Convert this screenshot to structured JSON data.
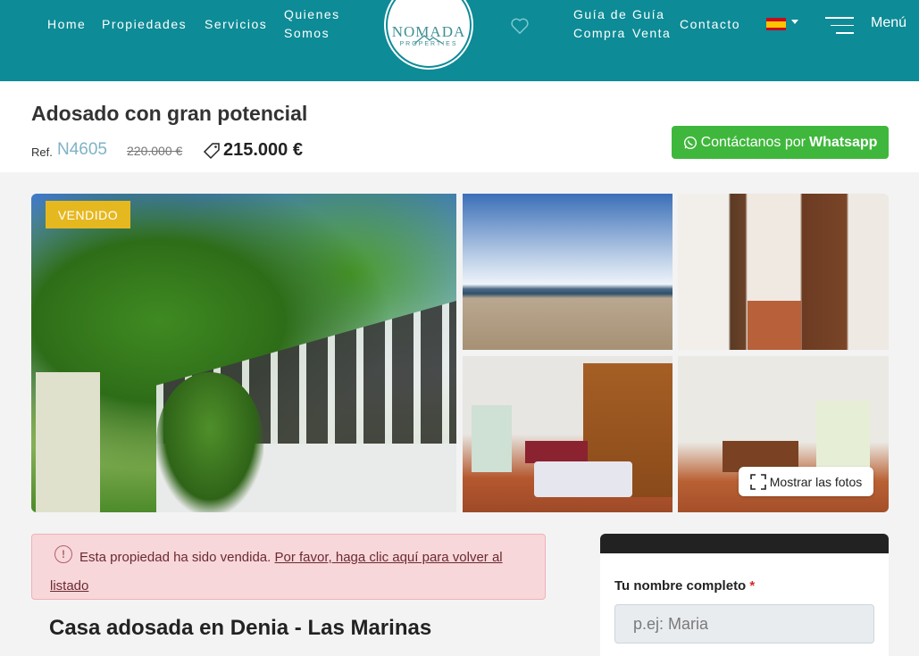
{
  "header": {
    "nav": [
      {
        "label": "Home"
      },
      {
        "label": "Propiedades"
      },
      {
        "label": "Servicios"
      },
      {
        "label": "Quienes Somos"
      },
      {
        "label": "Guía de Compra"
      },
      {
        "label": "Guía Venta"
      },
      {
        "label": "Contacto"
      }
    ],
    "logo_text": "NOMADA",
    "logo_sub": "PROPERTIES",
    "menu_label": "Menú",
    "language": "es"
  },
  "property": {
    "title": "Adosado con gran potencial",
    "ref_label": "Ref.",
    "ref": "N4605",
    "old_price": "220.000 €",
    "price": "215.000 €",
    "whatsapp_prefix": "Contáctanos por",
    "whatsapp_bold": "Whatsapp",
    "badge": "VENDIDO",
    "show_photos": "Mostrar las fotos",
    "subtitle": "Casa adosada en Denia  -  Las Marinas"
  },
  "alert": {
    "text": "Esta propiedad ha sido vendida.",
    "link": "Por favor, haga clic aquí para volver al listado"
  },
  "form": {
    "name_label": "Tu nombre completo",
    "required_mark": "*",
    "name_placeholder": "p.ej: Maria"
  },
  "colors": {
    "header_bg": "#0d8b96",
    "whatsapp": "#3fb73c",
    "badge": "#e6b820",
    "alert_bg": "#f8d7da"
  }
}
